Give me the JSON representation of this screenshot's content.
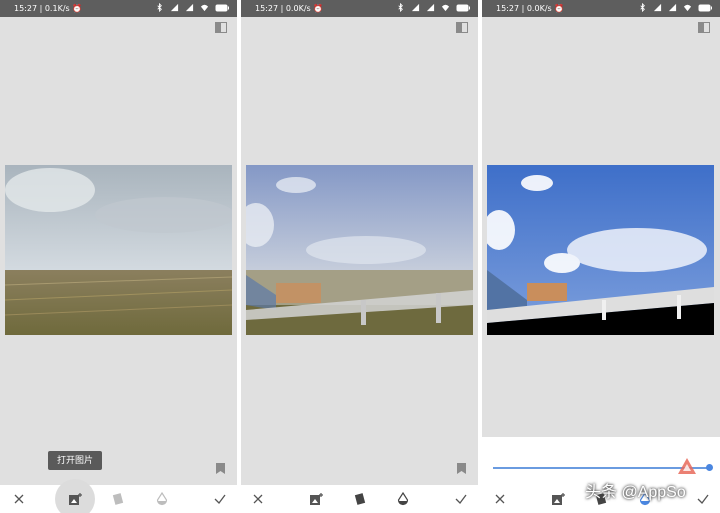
{
  "panels": [
    {
      "status": {
        "time": "15:27",
        "speed": "0.1K/s"
      },
      "open_image_label": "打开图片"
    },
    {
      "status": {
        "time": "15:27",
        "speed": "0.0K/s"
      }
    },
    {
      "status": {
        "time": "15:27",
        "speed": "0.0K/s"
      }
    }
  ],
  "watermark": "头条 @AppSo",
  "colors": {
    "panel_bg": "#e0e0e0",
    "statusbar": "#5e5e5e",
    "slider_accent": "#4a86e0"
  },
  "icons": [
    "close-icon",
    "add-image-icon",
    "layers-icon",
    "droplet-icon",
    "check-icon",
    "compare-icon",
    "bookmark-icon"
  ]
}
